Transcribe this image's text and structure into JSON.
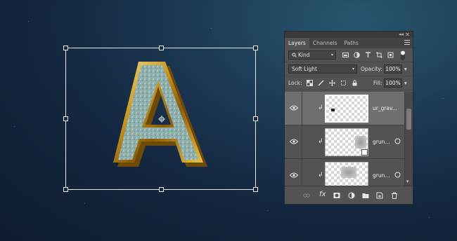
{
  "panel": {
    "tabs": [
      "Layers",
      "Channels",
      "Paths"
    ],
    "filter": {
      "label": "Kind"
    },
    "blend_mode": "Soft Light",
    "opacity": {
      "label": "Opacity:",
      "value": "100%"
    },
    "lock": {
      "label": "Lock:"
    },
    "fill": {
      "label": "Fill:",
      "value": "100%"
    },
    "layers": [
      {
        "name": "ur_grav...",
        "selected": true
      },
      {
        "name": "grun...",
        "selected": false
      },
      {
        "name": "grun...",
        "selected": false
      }
    ]
  },
  "canvas": {
    "letter": "A"
  }
}
